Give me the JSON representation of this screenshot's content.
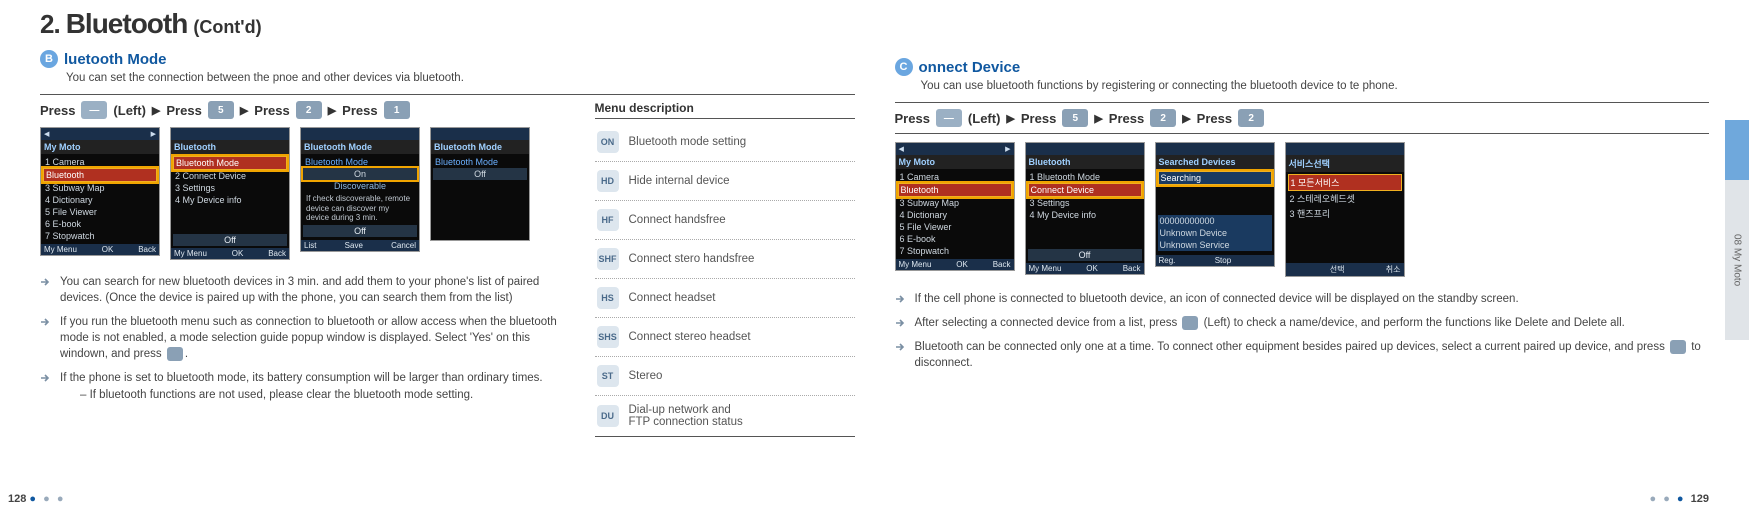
{
  "heading": {
    "num": "2.",
    "title": "Bluetooth",
    "contd": "(Cont'd)"
  },
  "left": {
    "circle": "B",
    "subtitle_rest": "luetooth Mode",
    "intro": "You can set the connection between the pnoe and other devices via bluetooth.",
    "press": {
      "w1": "Press",
      "softL": "(Left)",
      "w2": "Press",
      "k1": "5",
      "w3": "Press",
      "k2": "2",
      "w4": "Press",
      "k3": "1"
    },
    "menu_desc_hdr": "Menu description",
    "shots": {
      "s1": {
        "title": "My Moto",
        "rows": [
          "1 Camera",
          "Bluetooth",
          "3 Subway Map",
          "4 Dictionary",
          "5 File Viewer",
          "6 E-book",
          "7 Stopwatch"
        ],
        "hl": "Bluetooth",
        "foot": [
          "My Menu",
          "OK",
          "Back"
        ]
      },
      "s2": {
        "title": "Bluetooth",
        "rows": [
          "Bluetooth Mode",
          "2 Connect Device",
          "3 Settings",
          "4 My Device info"
        ],
        "hl": "Bluetooth Mode",
        "off": "Off",
        "foot": [
          "My Menu",
          "OK",
          "Back"
        ]
      },
      "s3": {
        "title": "Bluetooth Mode",
        "blue": "Bluetooth Mode",
        "on": "On",
        "disc": "Discoverable",
        "msg": "If check discoverable, remote device can discover my device during 3 min.",
        "off": "Off",
        "foot": [
          "List",
          "Save",
          "Cancel"
        ]
      },
      "s4": {
        "title": "Bluetooth Mode",
        "blue": "Bluetooth Mode",
        "off": "Off"
      }
    },
    "bullets": [
      "You can search for new bluetooth devices in 3 min. and add them to your phone's list of paired devices. (Once the device is paired up with the phone, you can search them from the list)",
      "If you run the bluetooth menu such as connection to bluetooth or allow access when the bluetooth mode is not enabled, a mode selection guide popup window is displayed. Select 'Yes' on this windown, and press",
      "If the phone is set to bluetooth mode, its battery consumption will be larger than ordinary times."
    ],
    "bullet_sub": "–  If bluetooth functions are not used, please clear the bluetooth mode setting.",
    "menu_items": [
      {
        "icon": "ON",
        "label": "Bluetooth mode setting"
      },
      {
        "icon": "HD",
        "label": "Hide internal device"
      },
      {
        "icon": "HF",
        "label": "Connect handsfree"
      },
      {
        "icon": "SHF",
        "label": "Connect stero handsfree"
      },
      {
        "icon": "HS",
        "label": "Connect headset"
      },
      {
        "icon": "SHS",
        "label": "Connect stereo headset"
      },
      {
        "icon": "ST",
        "label": "Stereo"
      },
      {
        "icon": "DU",
        "label": "Dial-up network and\nFTP connection status"
      }
    ]
  },
  "right": {
    "circle": "C",
    "subtitle_rest": "onnect Device",
    "intro": "You can use bluetooth functions by registering or connecting the bluetooth device to te phone.",
    "press": {
      "w1": "Press",
      "softL": "(Left)",
      "w2": "Press",
      "k1": "5",
      "w3": "Press",
      "k2": "2",
      "w4": "Press",
      "k3": "2"
    },
    "shots": {
      "s1": {
        "title": "My Moto",
        "rows": [
          "1 Camera",
          "Bluetooth",
          "3 Subway Map",
          "4 Dictionary",
          "5 File Viewer",
          "6 E-book",
          "7 Stopwatch"
        ],
        "hl": "Bluetooth",
        "foot": [
          "My Menu",
          "OK",
          "Back"
        ]
      },
      "s2": {
        "title": "Bluetooth",
        "rows": [
          "1 Bluetooth Mode",
          "Connect Device",
          "3 Settings",
          "4 My Device info"
        ],
        "hl": "Connect Device",
        "off": "Off",
        "foot": [
          "My Menu",
          "OK",
          "Back"
        ]
      },
      "s3": {
        "title": "Searched Devices",
        "hlrow": "Searching",
        "rows": [
          "00000000000",
          "Unknown Device",
          "Unknown Service"
        ],
        "foot": [
          "Reg.",
          "Stop",
          ""
        ]
      },
      "s4": {
        "title": "서비스선택",
        "rows": [
          "1 모든서비스",
          "2 스테레오헤드셋",
          "3 핸즈프리"
        ],
        "foot": [
          "",
          "선택",
          "취소"
        ]
      }
    },
    "bullets": [
      "If the cell phone is connected to bluetooth device, an icon of connected device will be displayed on the standby screen.",
      "After selecting a connected device from a list, press        (Left) to check a name/device, and perform the functions like Delete and Delete all.",
      "Bluetooth can be connected only one at a time. To connect other equipment besides paired up devices, select a current paired up device, and press        to disconnect."
    ]
  },
  "side_tab": "08  My Moto",
  "footer": {
    "left_num": "128",
    "right_num": "129"
  }
}
